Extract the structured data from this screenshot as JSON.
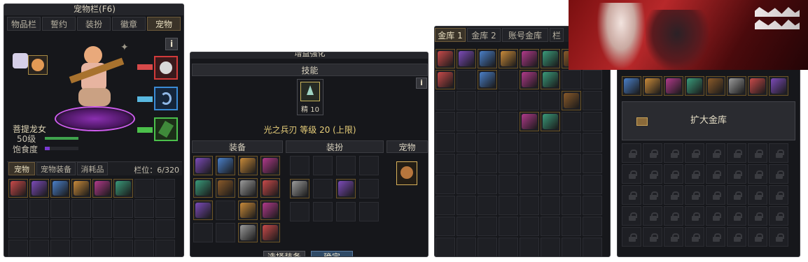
{
  "pet_window": {
    "title": "宠物栏(F6)",
    "tabs": [
      "物品栏",
      "誓约",
      "装扮",
      "徽章",
      "宠物"
    ],
    "active_tab": "宠物",
    "info_button": "i",
    "pet_name": "菩提龙女",
    "pet_level": "50级",
    "satiety_label": "饱食度",
    "sub_tabs": [
      "宠物",
      "宠物装备",
      "消耗品"
    ],
    "slots_label": "栏位：6/320"
  },
  "enhance_window": {
    "title": "增益强化",
    "skill_header": "技能",
    "skill_rank_label": "精 10",
    "skill_info": "光之兵刃 等级 20 (上限)",
    "info_button": "i",
    "col_equipment": "装备",
    "col_avatar": "装扮",
    "col_pet": "宠物",
    "select_equipment_button": "选择装备",
    "confirm_button": "确定"
  },
  "vault_window": {
    "tabs": [
      "金库 1",
      "金库 2",
      "账号金库",
      "栏"
    ],
    "active_tab": "金库 1"
  },
  "account_vault_window": {
    "expand_button": "扩大金库"
  },
  "colors": {
    "accent_gold": "#d8b15a",
    "satiety_bar": "#7a3ad1",
    "level_bar": "#3fa34d",
    "pet_circle": "#b43ad6"
  }
}
